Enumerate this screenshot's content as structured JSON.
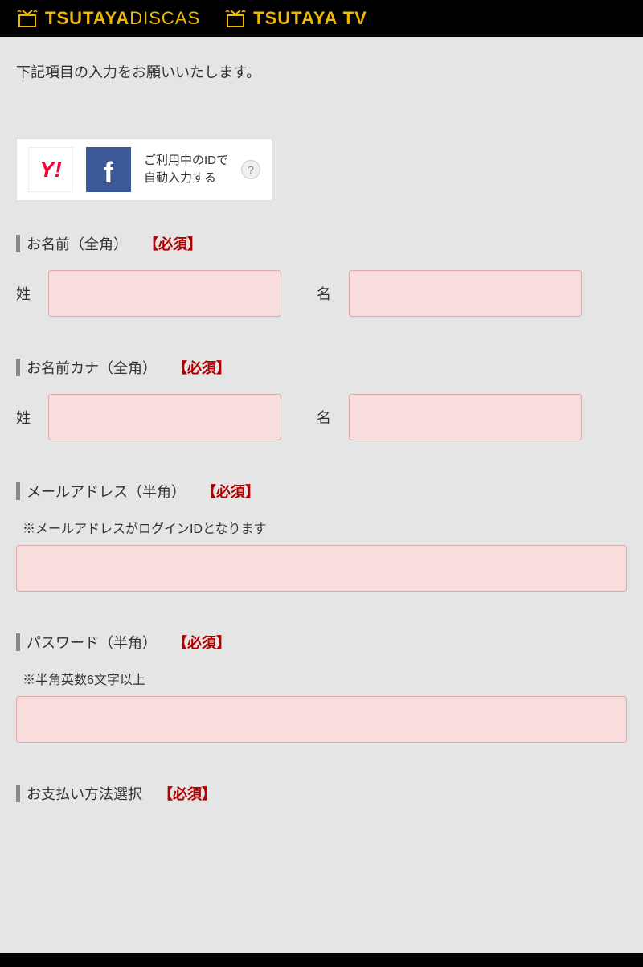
{
  "header": {
    "logo1_brand": "TSUTAYA",
    "logo1_sub": "DISCAS",
    "logo2_brand": "TSUTAYA",
    "logo2_sub": "TV"
  },
  "intro": "下記項目の入力をお願いいたします。",
  "social": {
    "yahoo_label": "Y!",
    "fb_label": "f",
    "text_line1": "ご利用中のIDで",
    "text_line2": "自動入力する",
    "help": "?"
  },
  "required_tag": "【必須】",
  "sections": {
    "name": {
      "label": "お名前（全角）",
      "sei": "姓",
      "mei": "名"
    },
    "kana": {
      "label": "お名前カナ（全角）",
      "sei": "姓",
      "mei": "名"
    },
    "email": {
      "label": "メールアドレス（半角）",
      "note": "※メールアドレスがログインIDとなります"
    },
    "password": {
      "label": "パスワード（半角）",
      "note": "※半角英数6文字以上"
    },
    "payment": {
      "label": "お支払い方法選択"
    }
  }
}
